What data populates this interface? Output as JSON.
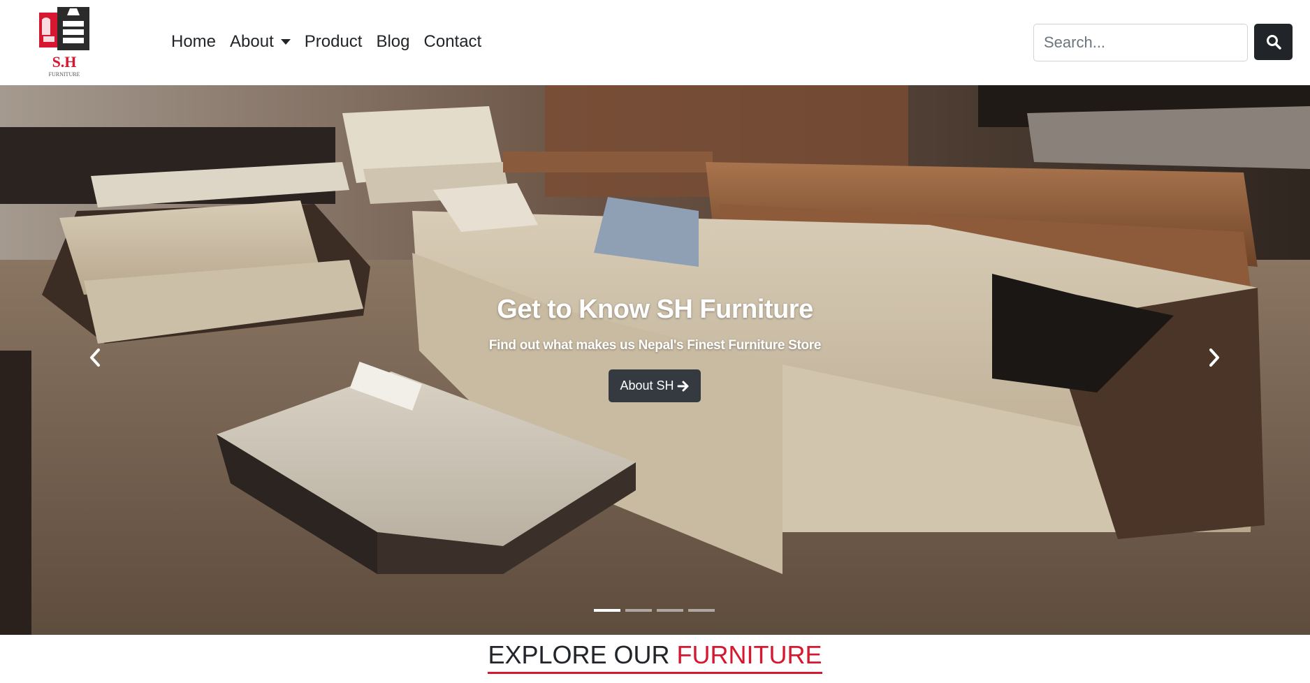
{
  "brand": {
    "logo_text": "S.H",
    "logo_subtext": "FURNITURE",
    "accent_color": "#d6172f"
  },
  "nav": {
    "items": [
      {
        "label": "Home"
      },
      {
        "label": "About",
        "has_dropdown": true
      },
      {
        "label": "Product"
      },
      {
        "label": "Blog"
      },
      {
        "label": "Contact"
      }
    ]
  },
  "search": {
    "placeholder": "Search...",
    "value": "",
    "button_icon": "search-icon"
  },
  "carousel": {
    "title": "Get to Know SH Furniture",
    "subtitle": "Find out what makes us Nepal's Finest Furniture Store",
    "button_label": "About SH",
    "button_icon": "arrow-right-icon",
    "prev_icon": "chevron-left-icon",
    "next_icon": "chevron-right-icon",
    "slide_count": 4,
    "active_slide": 1
  },
  "section": {
    "heading_plain": "EXPLORE OUR ",
    "heading_accent": "FURNITURE"
  }
}
